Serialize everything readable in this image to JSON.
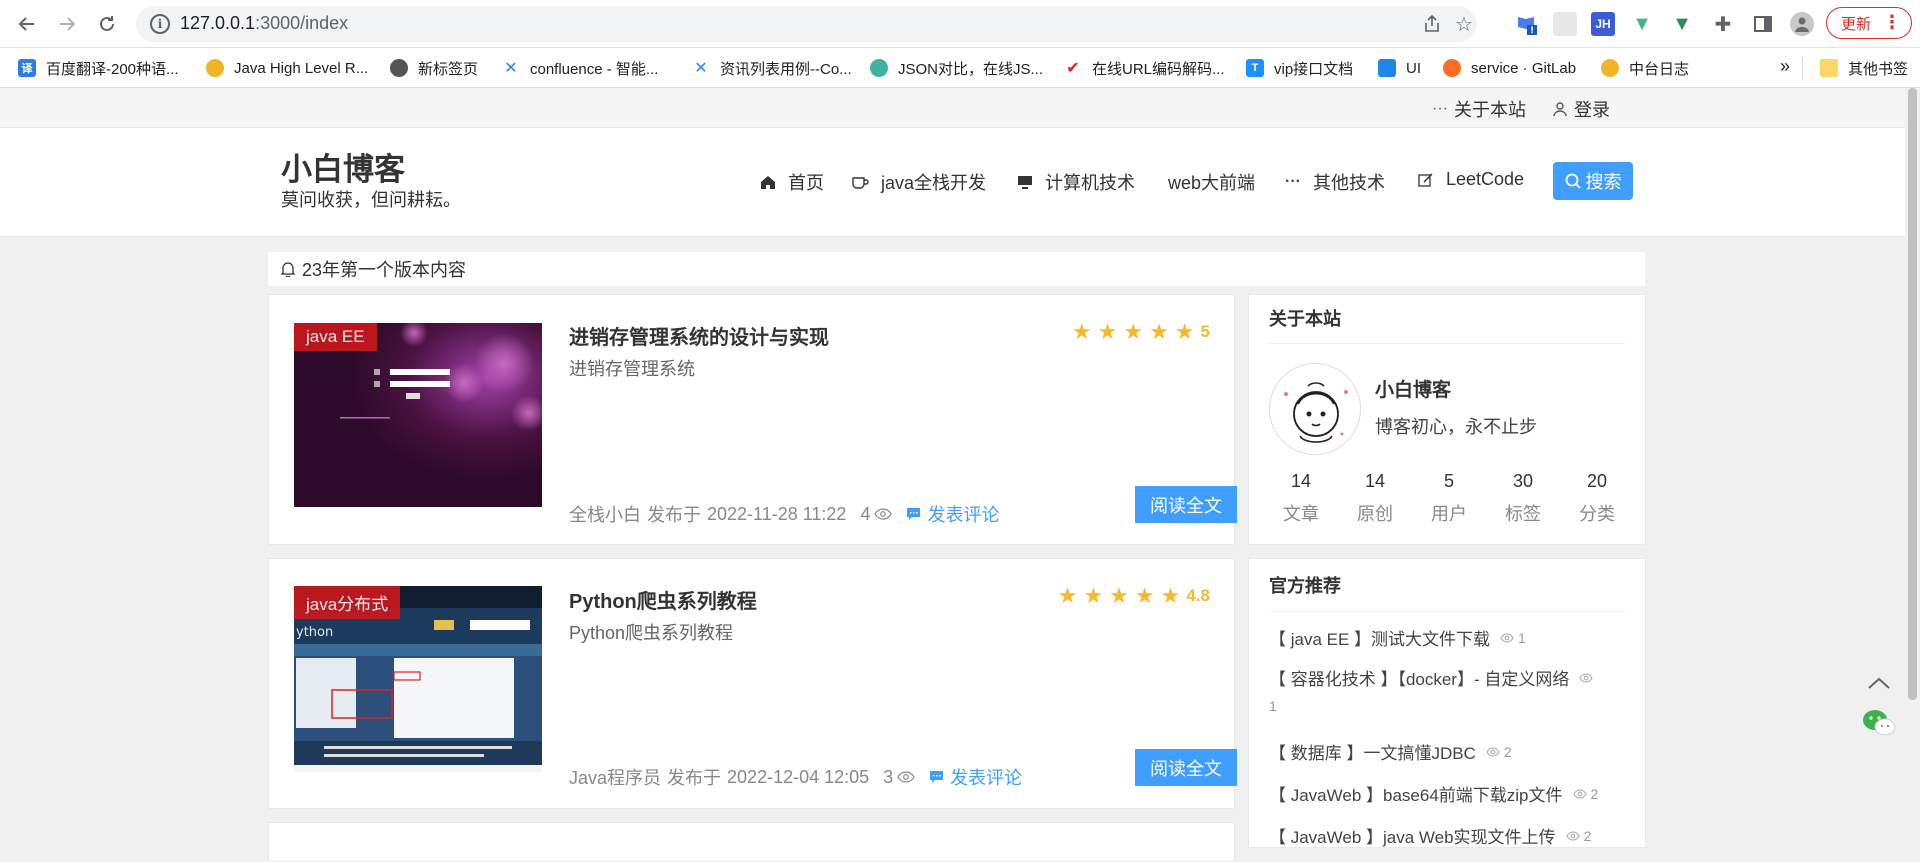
{
  "browser": {
    "url_host": "127.0.0.1",
    "url_rest": ":3000/index",
    "update_label": "更新",
    "ext_jh": "JH"
  },
  "bookmarks": [
    {
      "label": "百度翻译-200种语...",
      "icon": "translate-icon",
      "color": "#2b7de9",
      "glyph": "译"
    },
    {
      "label": "Java High Level R...",
      "icon": "elastic-icon",
      "color": "#f0b429",
      "glyph": ""
    },
    {
      "label": "新标签页",
      "icon": "globe-icon",
      "color": "#555555",
      "glyph": ""
    },
    {
      "label": "confluence - 智能...",
      "icon": "confluence-icon",
      "color": "#2684ff",
      "glyph": ""
    },
    {
      "label": "资讯列表用例--Co...",
      "icon": "confluence-icon",
      "color": "#2684ff",
      "glyph": ""
    },
    {
      "label": "JSON对比，在线JS...",
      "icon": "json-icon",
      "color": "#3cb4a0",
      "glyph": ""
    },
    {
      "label": "在线URL编码解码...",
      "icon": "check-icon",
      "color": "#e02020",
      "glyph": ""
    },
    {
      "label": "vip接口文档",
      "icon": "doc-icon",
      "color": "#1e90ff",
      "glyph": "T"
    },
    {
      "label": "UI",
      "icon": "ui-icon",
      "color": "#1e88e5",
      "glyph": ""
    },
    {
      "label": "service · GitLab",
      "icon": "gitlab-icon",
      "color": "#fc6d26",
      "glyph": ""
    },
    {
      "label": "中台日志",
      "icon": "elastic-icon",
      "color": "#f0b429",
      "glyph": ""
    }
  ],
  "bookmarks_more": "»",
  "bookmarks_other": "其他书签",
  "topbar": {
    "about": "关于本站",
    "login": "登录"
  },
  "site": {
    "logo": "小白博客",
    "slogan": "莫问收获，但问耕耘。"
  },
  "menu": [
    {
      "label": "首页",
      "icon": "home-icon"
    },
    {
      "label": "java全栈开发",
      "icon": "coffee-icon"
    },
    {
      "label": "计算机技术",
      "icon": "monitor-icon"
    },
    {
      "label": "web大前端",
      "icon": ""
    },
    {
      "label": "其他技术",
      "icon": "more-icon"
    },
    {
      "label": "LeetCode",
      "icon": "edit-icon"
    }
  ],
  "search_label": "搜索",
  "notice": "23年第一个版本内容",
  "posts": [
    {
      "tag": "java EE",
      "title": "进销存管理系统的设计与实现",
      "subtitle": "进销存管理系统",
      "rating": 5,
      "rating_label": "5",
      "author": "全栈小白",
      "published_label": "发布于",
      "date": "2022-11-28 11:22",
      "views": "4",
      "comment_label": "发表评论",
      "read_label": "阅读全文"
    },
    {
      "tag": "java分布式",
      "title": "Python爬虫系列教程",
      "subtitle": "Python爬虫系列教程",
      "rating": 4.8,
      "rating_label": "4.8",
      "author": "Java程序员",
      "published_label": "发布于",
      "date": "2022-12-04 12:05",
      "views": "3",
      "comment_label": "发表评论",
      "read_label": "阅读全文"
    }
  ],
  "about_box": {
    "title": "关于本站",
    "name": "小白博客",
    "motto": "博客初心，永不止步",
    "stats": [
      {
        "value": "14",
        "label": "文章"
      },
      {
        "value": "14",
        "label": "原创"
      },
      {
        "value": "5",
        "label": "用户"
      },
      {
        "value": "30",
        "label": "标签"
      },
      {
        "value": "20",
        "label": "分类"
      }
    ]
  },
  "recommend": {
    "title": "官方推荐",
    "items": [
      {
        "text": "【 java EE 】测试大文件下载",
        "views": "1"
      },
      {
        "text": "【 容器化技术 】【docker】- 自定义网络",
        "views": "1"
      },
      {
        "text": "【 数据库 】一文搞懂JDBC",
        "views": "2"
      },
      {
        "text": "【 JavaWeb 】base64前端下载zip文件",
        "views": "2"
      },
      {
        "text": "【 JavaWeb 】java Web实现文件上传",
        "views": "2"
      }
    ]
  }
}
